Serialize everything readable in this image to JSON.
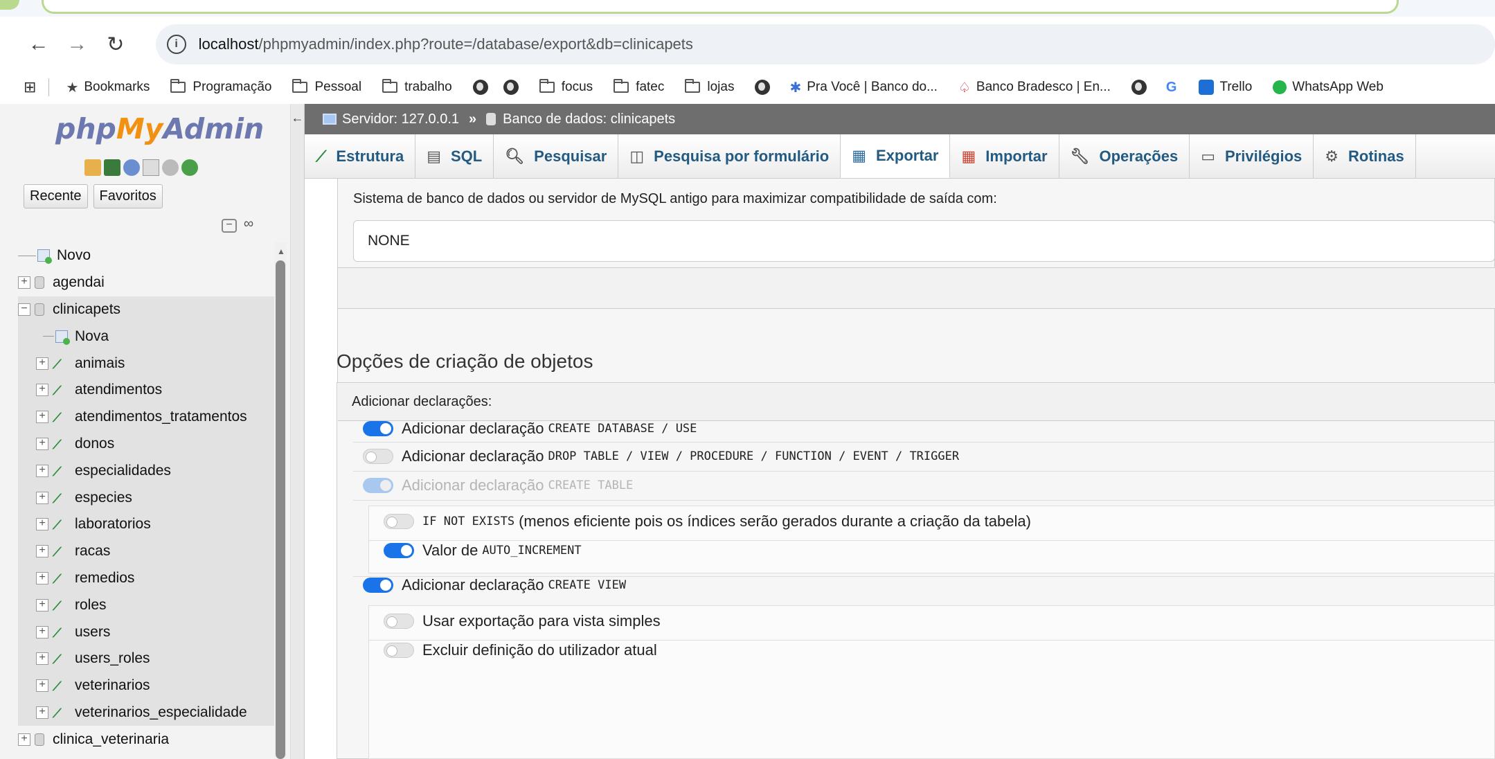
{
  "browser": {
    "url_host": "localhost",
    "url_path": "/phpmyadmin/index.php?route=/database/export&db=clinicapets",
    "bookmarks": [
      {
        "label": "Bookmarks",
        "icon": "star-icon"
      },
      {
        "label": "Programação",
        "icon": "folder-icon"
      },
      {
        "label": "Pessoal",
        "icon": "folder-icon"
      },
      {
        "label": "trabalho",
        "icon": "folder-icon"
      },
      {
        "label": "",
        "icon": "globe-icon"
      },
      {
        "label": "",
        "icon": "globe-icon"
      },
      {
        "label": "focus",
        "icon": "folder-icon"
      },
      {
        "label": "fatec",
        "icon": "folder-icon"
      },
      {
        "label": "lojas",
        "icon": "folder-icon"
      },
      {
        "label": "",
        "icon": "globe-icon"
      },
      {
        "label": "Pra Você | Banco do...",
        "icon": "bb-icon"
      },
      {
        "label": "Banco Bradesco | En...",
        "icon": "bradesco-icon"
      },
      {
        "label": "",
        "icon": "globe-icon"
      },
      {
        "label": "",
        "icon": "google-icon"
      },
      {
        "label": "Trello",
        "icon": "trello-icon"
      },
      {
        "label": "WhatsApp Web",
        "icon": "whatsapp-icon"
      }
    ]
  },
  "sidebar": {
    "logo": {
      "php": "php",
      "my": "My",
      "admin": "Admin"
    },
    "recent_label": "Recente",
    "favorites_label": "Favoritos",
    "tree": [
      {
        "label": "Novo",
        "type": "new",
        "level": 0
      },
      {
        "label": "agendai",
        "type": "db",
        "level": 0
      },
      {
        "label": "clinicapets",
        "type": "db",
        "level": 0,
        "selected": true
      },
      {
        "label": "Nova",
        "type": "new",
        "level": 1
      },
      {
        "label": "animais",
        "type": "table",
        "level": 1
      },
      {
        "label": "atendimentos",
        "type": "table",
        "level": 1
      },
      {
        "label": "atendimentos_tratamentos",
        "type": "table",
        "level": 1
      },
      {
        "label": "donos",
        "type": "table",
        "level": 1
      },
      {
        "label": "especialidades",
        "type": "table",
        "level": 1
      },
      {
        "label": "especies",
        "type": "table",
        "level": 1
      },
      {
        "label": "laboratorios",
        "type": "table",
        "level": 1
      },
      {
        "label": "racas",
        "type": "table",
        "level": 1
      },
      {
        "label": "remedios",
        "type": "table",
        "level": 1
      },
      {
        "label": "roles",
        "type": "table",
        "level": 1
      },
      {
        "label": "users",
        "type": "table",
        "level": 1
      },
      {
        "label": "users_roles",
        "type": "table",
        "level": 1
      },
      {
        "label": "veterinarios",
        "type": "table",
        "level": 1
      },
      {
        "label": "veterinarios_especialidade",
        "type": "table",
        "level": 1
      },
      {
        "label": "clinica_veterinaria",
        "type": "db",
        "level": 0
      }
    ]
  },
  "breadcrumb": {
    "server": "Servidor: 127.0.0.1",
    "sep": "»",
    "database": "Banco de dados: clinicapets"
  },
  "menu": [
    {
      "label": "Estrutura",
      "icon": "structure-icon"
    },
    {
      "label": "SQL",
      "icon": "sql-icon"
    },
    {
      "label": "Pesquisar",
      "icon": "search-icon"
    },
    {
      "label": "Pesquisa por formulário",
      "icon": "query-icon"
    },
    {
      "label": "Exportar",
      "icon": "export-icon",
      "active": true
    },
    {
      "label": "Importar",
      "icon": "import-icon"
    },
    {
      "label": "Operações",
      "icon": "wrench-icon"
    },
    {
      "label": "Privilégios",
      "icon": "privileges-icon"
    },
    {
      "label": "Rotinas",
      "icon": "routines-icon"
    }
  ],
  "export": {
    "compat_label": "Sistema de banco de dados ou servidor de MySQL antigo para maximizar compatibilidade de saída com:",
    "compat_value": "NONE",
    "section_title": "Opções de criação de objetos",
    "add_statements_label": "Adicionar declarações:",
    "options": [
      {
        "text": "Adicionar declaração",
        "code": "CREATE DATABASE / USE",
        "state": "on"
      },
      {
        "text": "Adicionar declaração",
        "code": "DROP TABLE / VIEW / PROCEDURE / FUNCTION / EVENT / TRIGGER",
        "state": "off"
      },
      {
        "text": "Adicionar declaração",
        "code": "CREATE TABLE",
        "state": "disabled"
      },
      {
        "code_prefix": "IF NOT EXISTS",
        "text": "(menos eficiente pois os índices serão gerados durante a criação da tabela)",
        "state": "off"
      },
      {
        "text": "Valor de",
        "code": "AUTO_INCREMENT",
        "state": "on"
      },
      {
        "text": "Adicionar declaração",
        "code": "CREATE VIEW",
        "state": "on"
      },
      {
        "text": "Usar exportação para vista simples",
        "state": "off"
      },
      {
        "text": "Excluir definição do utilizador atual",
        "state": "off"
      }
    ]
  }
}
